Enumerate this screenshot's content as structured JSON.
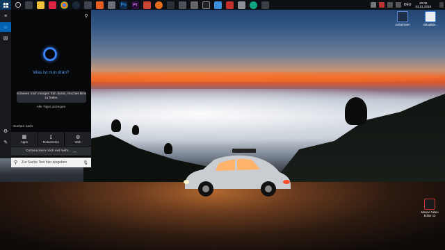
{
  "taskbar": {
    "language": "DEU",
    "time": "20:05",
    "date": "03.01.2018",
    "pinned": [
      "file-explorer-icon",
      "cortana-icon",
      "chrome-icon",
      "steam-icon",
      "media-icon",
      "photoshop-icon",
      "premiere-icon",
      "video-icon",
      "game-icon",
      "settings-icon",
      "screenshot-icon",
      "app-icon"
    ]
  },
  "cortana": {
    "heading": "Was ist nun dran?",
    "reminder": "Erinnere mich morgen früh daran, frisches Brot zu holen.",
    "all_tips": "Alle Tipps anzeigen",
    "search_in": "Suchen nach",
    "filters": [
      {
        "label": "Apps"
      },
      {
        "label": "Dokumente"
      },
      {
        "label": "Web"
      }
    ],
    "more": "Cortana kann noch viel mehr...",
    "search_placeholder": "Zur Suche Text hier eingeben"
  },
  "desktop_icons": [
    {
      "label": "Aufnehmen"
    },
    {
      "label": "Aktualisie..."
    },
    {
      "label": "Movavi Video Editor 12"
    }
  ]
}
